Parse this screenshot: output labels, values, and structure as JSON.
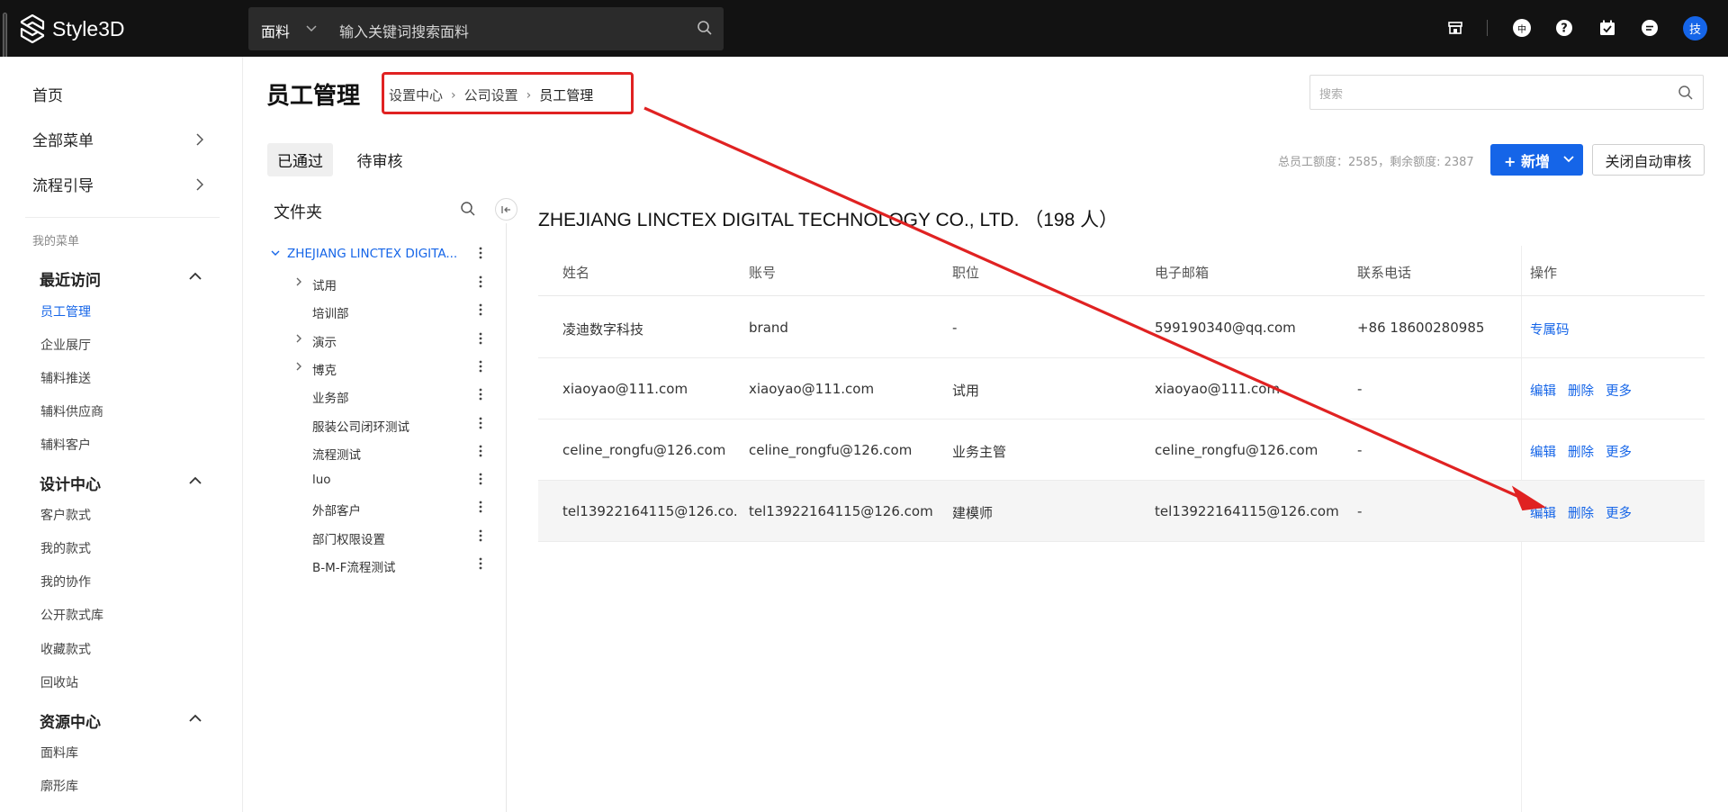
{
  "app": {
    "name": "Style3D"
  },
  "search": {
    "category": "面料",
    "placeholder": "输入关键词搜索面料"
  },
  "topbar_icons": [
    "store-icon",
    "language-icon",
    "help-icon",
    "tasks-icon",
    "message-icon"
  ],
  "topbar_language_glyph": "中",
  "user": {
    "avatar_text": "技"
  },
  "sidebar": {
    "main": [
      {
        "label": "首页"
      },
      {
        "label": "全部菜单"
      },
      {
        "label": "流程引导"
      }
    ],
    "my_menu_label": "我的菜单",
    "groups": [
      {
        "title": "最近访问",
        "items": [
          "员工管理",
          "企业展厅",
          "辅料推送",
          "辅料供应商",
          "辅料客户"
        ]
      },
      {
        "title": "设计中心",
        "items": [
          "客户款式",
          "我的款式",
          "我的协作",
          "公开款式库",
          "收藏款式",
          "回收站"
        ]
      },
      {
        "title": "资源中心",
        "items": [
          "面料库",
          "廓形库"
        ]
      }
    ],
    "active_item": "员工管理"
  },
  "page": {
    "title": "员工管理",
    "breadcrumb": [
      "设置中心",
      "公司设置",
      "员工管理"
    ],
    "search_placeholder": "搜索"
  },
  "tabs": [
    "已通过",
    "待审核"
  ],
  "quota_text": "总员工额度：2585，剩余额度: 2387",
  "buttons": {
    "add": "+ 新增",
    "auto_review": "关闭自动审核"
  },
  "folder": {
    "title": "文件夹",
    "tree": [
      {
        "label": "ZHEJIANG LINCTEX DIGITA...",
        "level": 0,
        "expanded": true
      },
      {
        "label": "试用",
        "level": 1,
        "has_children": true
      },
      {
        "label": "培训部",
        "level": 1,
        "has_children": false
      },
      {
        "label": "演示",
        "level": 1,
        "has_children": true
      },
      {
        "label": "博克",
        "level": 1,
        "has_children": true
      },
      {
        "label": "业务部",
        "level": 1,
        "has_children": false
      },
      {
        "label": "服装公司闭环测试",
        "level": 1,
        "has_children": false
      },
      {
        "label": "流程测试",
        "level": 1,
        "has_children": false
      },
      {
        "label": "luo",
        "level": 1,
        "has_children": false
      },
      {
        "label": "外部客户",
        "level": 1,
        "has_children": false
      },
      {
        "label": "部门权限设置",
        "level": 1,
        "has_children": false
      },
      {
        "label": "B-M-F流程测试",
        "level": 1,
        "has_children": false
      }
    ]
  },
  "table": {
    "company_title": "ZHEJIANG LINCTEX DIGITAL TECHNOLOGY CO., LTD. （198 人）",
    "columns": [
      "姓名",
      "账号",
      "职位",
      "电子邮箱",
      "联系电话",
      "操作"
    ],
    "rows": [
      {
        "name": "凌迪数字科技",
        "account": "brand",
        "position": "-",
        "email": "599190340@qq.com",
        "phone": "+86 18600280985",
        "actions": [
          "专属码"
        ]
      },
      {
        "name": "xiaoyao@111.com",
        "account": "xiaoyao@111.com",
        "position": "试用",
        "email": "xiaoyao@111.com",
        "phone": "-",
        "actions": [
          "编辑",
          "删除",
          "更多"
        ]
      },
      {
        "name": "celine_rongfu@126.com",
        "account": "celine_rongfu@126.com",
        "position": "业务主管",
        "email": "celine_rongfu@126.com",
        "phone": "-",
        "actions": [
          "编辑",
          "删除",
          "更多"
        ]
      },
      {
        "name": "tel13922164115@126.co...",
        "account": "tel13922164115@126.com",
        "position": "建模师",
        "email": "tel13922164115@126.com",
        "phone": "-",
        "actions": [
          "编辑",
          "删除",
          "更多"
        ]
      }
    ]
  },
  "colors": {
    "accent": "#1565e8",
    "annotation": "#e02222",
    "topbar": "#121212"
  }
}
